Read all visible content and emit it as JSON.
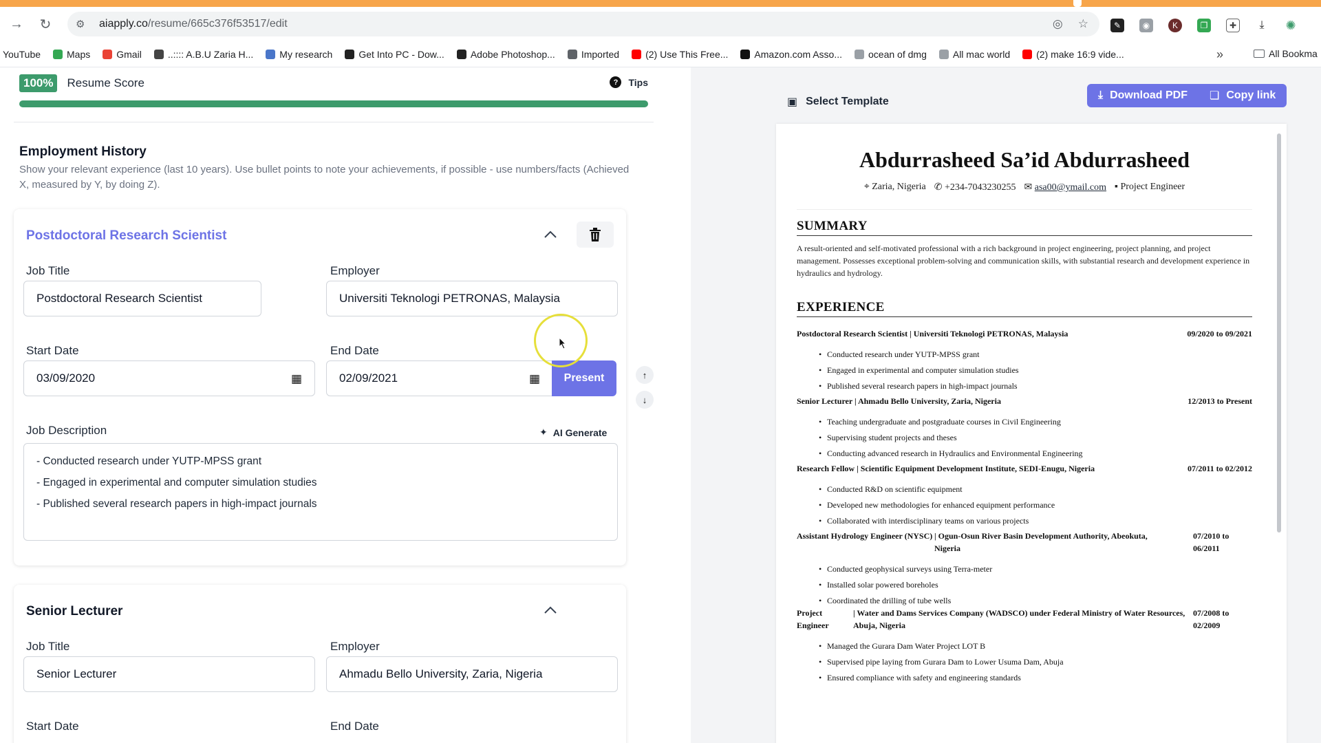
{
  "browser": {
    "url_host": "aiapply.co",
    "url_path": "/resume/665c376f53517/edit",
    "bookmarks": [
      {
        "label": "YouTube",
        "color": "#ff0000"
      },
      {
        "label": "Maps",
        "color": "#34a853"
      },
      {
        "label": "Gmail",
        "color": "#ea4335"
      },
      {
        "label": "..:::: A.B.U Zaria H...",
        "color": "#444444"
      },
      {
        "label": "My research",
        "color": "#4a76c9"
      },
      {
        "label": "Get Into PC - Dow...",
        "color": "#222222"
      },
      {
        "label": "Adobe Photoshop...",
        "color": "#222222"
      },
      {
        "label": "Imported",
        "color": "#5f6368"
      },
      {
        "label": "(2) Use This Free...",
        "color": "#ff0000"
      },
      {
        "label": "Amazon.com Asso...",
        "color": "#111111"
      },
      {
        "label": "ocean of dmg",
        "color": "#9aa0a6"
      },
      {
        "label": "All mac world",
        "color": "#9aa0a6"
      },
      {
        "label": "(2) make 16:9 vide...",
        "color": "#ff0000"
      }
    ],
    "all_bookmarks": "All Bookma"
  },
  "editor": {
    "score_badge": "100%",
    "score_label": "Resume Score",
    "score_progress": 1.0,
    "tips_label": "Tips",
    "section_title": "Employment History",
    "section_desc": "Show your relevant experience (last 10 years). Use bullet points to note your achievements, if possible - use numbers/facts (Achieved X, measured by Y, by doing Z).",
    "job1": {
      "header": "Postdoctoral Research Scientist",
      "job_title_label": "Job Title",
      "job_title": "Postdoctoral Research Scientist",
      "employer_label": "Employer",
      "employer": "Universiti Teknologi PETRONAS, Malaysia",
      "start_label": "Start Date",
      "start": "03/09/2020",
      "end_label": "End Date",
      "end": "02/09/2021",
      "present_label": "Present",
      "desc_label": "Job Description",
      "ai_label": "AI Generate",
      "desc_lines": [
        "- Conducted research under YUTP-MPSS grant",
        "- Engaged in experimental and computer simulation studies",
        "- Published several research papers in high-impact journals"
      ]
    },
    "job2": {
      "header": "Senior Lecturer",
      "job_title_label": "Job Title",
      "job_title": "Senior Lecturer",
      "employer_label": "Employer",
      "employer": "Ahmadu Bello University, Zaria, Nigeria",
      "start_label": "Start Date",
      "end_label": "End Date"
    }
  },
  "preview": {
    "select_template": "Select Template",
    "download_pdf": "Download PDF",
    "copy_link": "Copy link",
    "accent": "#6d73e6",
    "resume": {
      "name": "Abdurrasheed Sa’id Abdurrasheed",
      "location": "Zaria, Nigeria",
      "phone": "+234-7043230255",
      "email": "asa00@ymail.com",
      "role": "Project Engineer",
      "summary_h": "SUMMARY",
      "summary": "A result-oriented and self-motivated professional with a rich background in project engineering, project planning, and project management. Possesses exceptional problem-solving and communication skills, with substantial research and development experience in hydraulics and hydrology.",
      "experience_h": "EXPERIENCE",
      "jobs": [
        {
          "title": "Postdoctoral Research Scientist | Universiti Teknologi PETRONAS, Malaysia",
          "dates": "09/2020 to 09/2021",
          "bullets": [
            "Conducted research under YUTP-MPSS grant",
            "Engaged in experimental and computer simulation studies",
            "Published several research papers in high-impact journals"
          ]
        },
        {
          "title": "Senior Lecturer | Ahmadu Bello University, Zaria, Nigeria",
          "dates": "12/2013 to Present",
          "bullets": [
            "Teaching undergraduate and postgraduate courses in Civil Engineering",
            "Supervising student projects and theses",
            "Conducting advanced research in Hydraulics and Environmental Engineering"
          ]
        },
        {
          "title": "Research Fellow | Scientific Equipment Development Institute, SEDI-Enugu, Nigeria",
          "dates": "07/2011 to 02/2012",
          "bullets": [
            "Conducted R&D on scientific equipment",
            "Developed new methodologies for enhanced equipment performance",
            "Collaborated with interdisciplinary teams on various projects"
          ]
        },
        {
          "title_a": "Assistant Hydrology Engineer (NYSC)",
          "title_b": "| Ogun-Osun River Basin Development Authority, Abeokuta, Nigeria",
          "dates": "07/2010 to 06/2011",
          "bullets": [
            "Conducted geophysical surveys using Terra-meter",
            "Installed solar powered boreholes",
            "Coordinated the drilling of tube wells"
          ]
        },
        {
          "title_a": "Project Engineer",
          "title_b": "| Water and Dams Services Company (WADSCO) under Federal Ministry of Water Resources, Abuja, Nigeria",
          "dates": "07/2008 to 02/2009",
          "bullets": [
            "Managed the Gurara Dam Water Project LOT B",
            "Supervised pipe laying from Gurara Dam to Lower Usuma Dam, Abuja",
            "Ensured compliance with safety and engineering standards"
          ]
        }
      ]
    }
  }
}
